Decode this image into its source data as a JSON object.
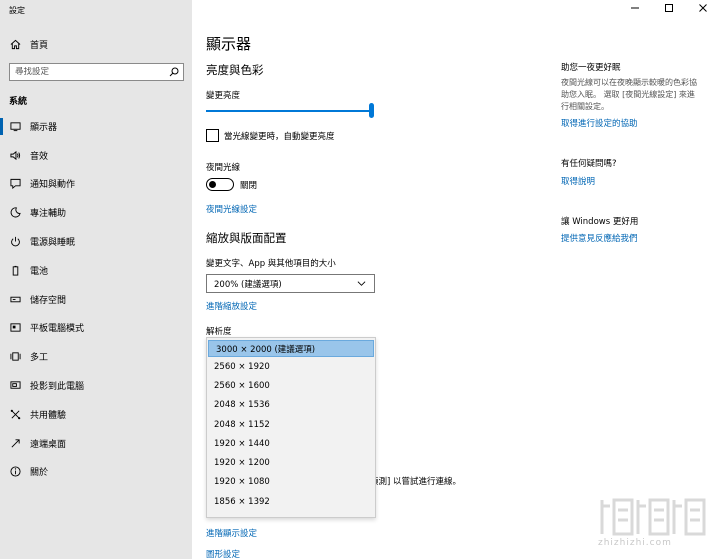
{
  "window": {
    "title": "設定",
    "controls": {
      "minimize": "minimize-icon",
      "maximize": "maximize-icon",
      "close": "close-icon"
    }
  },
  "sidebar": {
    "home_label": "首頁",
    "search_placeholder": "尋找設定",
    "section_title": "系統",
    "items": [
      {
        "label": "顯示器",
        "icon": "monitor-icon",
        "active": true
      },
      {
        "label": "音效",
        "icon": "speaker-icon"
      },
      {
        "label": "通知與動作",
        "icon": "notification-icon"
      },
      {
        "label": "專注輔助",
        "icon": "moon-icon"
      },
      {
        "label": "電源與睡眠",
        "icon": "power-icon"
      },
      {
        "label": "電池",
        "icon": "battery-icon"
      },
      {
        "label": "儲存空間",
        "icon": "storage-icon"
      },
      {
        "label": "平板電腦模式",
        "icon": "tablet-icon"
      },
      {
        "label": "多工",
        "icon": "multitask-icon"
      },
      {
        "label": "投影到此電腦",
        "icon": "project-icon"
      },
      {
        "label": "共用體驗",
        "icon": "share-icon"
      },
      {
        "label": "遠端桌面",
        "icon": "remote-icon"
      },
      {
        "label": "關於",
        "icon": "info-icon"
      }
    ]
  },
  "main": {
    "page_title": "顯示器",
    "brightness": {
      "heading": "亮度與色彩",
      "slider_label": "變更亮度",
      "level": 1.0,
      "auto_checkbox_label": "當光線變更時，自動變更亮度",
      "auto_checked": false
    },
    "night_light": {
      "label": "夜間光線",
      "state_label": "關閉",
      "on": false,
      "settings_link": "夜間光線設定"
    },
    "scale_layout": {
      "heading": "縮放與版面配置",
      "scale_label": "變更文字、App 與其他項目的大小",
      "scale_value": "200% (建議選項)",
      "advanced_link": "進階縮放設定",
      "resolution_label": "解析度",
      "resolution_options": [
        "3000 × 2000 (建議選項)",
        "2560 × 1920",
        "2560 × 1600",
        "2048 × 1536",
        "2048 × 1152",
        "1920 × 1440",
        "1920 × 1200",
        "1920 × 1080",
        "1856 × 1392"
      ],
      "selected_index": 0,
      "partial_text": "偵測] 以嘗試進行連線。"
    },
    "advanced_display_link": "進階顯示設定",
    "graphics_link": "圖形設定"
  },
  "right": {
    "sleep_heading": "助您一夜更好眠",
    "sleep_text": "夜間光線可以在夜晚顯示較暖的色彩協助您入眠。 選取 [夜間光線設定] 來進行相關設定。",
    "sleep_link": "取得進行設定的協助",
    "question_heading": "有任何疑問嗎?",
    "help_link": "取得說明",
    "better_heading": "讓 Windows 更好用",
    "feedback_link": "提供意見反應給我們"
  },
  "watermark": {
    "text": "zhizhizhi.com"
  },
  "colors": {
    "accent": "#0078d7",
    "link": "#0066b4",
    "sidebar_bg": "#e6e6e6",
    "selected_option": "#99c5ea"
  }
}
